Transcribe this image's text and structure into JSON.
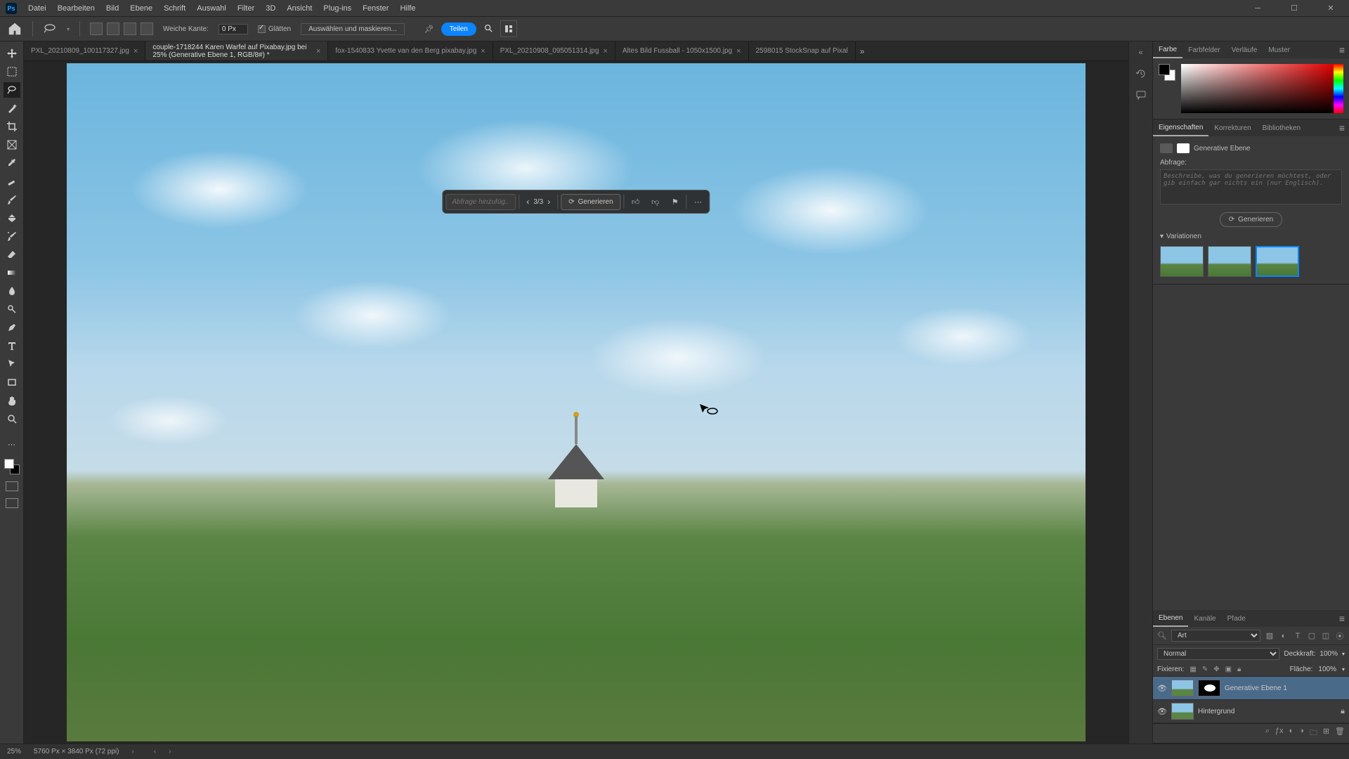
{
  "menu": [
    "Datei",
    "Bearbeiten",
    "Bild",
    "Ebene",
    "Schrift",
    "Auswahl",
    "Filter",
    "3D",
    "Ansicht",
    "Plug-ins",
    "Fenster",
    "Hilfe"
  ],
  "app_logo": "Ps",
  "options": {
    "feather_label": "Weiche Kante:",
    "feather_value": "0 Px",
    "antialias_label": "Glätten",
    "select_mask_label": "Auswählen und maskieren...",
    "share_label": "Teilen"
  },
  "tabs": [
    {
      "title": "PXL_20210809_100117327.jpg",
      "active": false
    },
    {
      "title": "couple-1718244 Karen Warfel auf Pixabay.jpg bei 25% (Generative Ebene 1, RGB/8#) *",
      "active": true
    },
    {
      "title": "fox-1540833 Yvette van den Berg pixabay.jpg",
      "active": false
    },
    {
      "title": "PXL_20210908_095051314.jpg",
      "active": false
    },
    {
      "title": "Altes Bild Fussball - 1050x1500.jpg",
      "active": false
    },
    {
      "title": "2598015 StockSnap auf Pixal",
      "active": false
    }
  ],
  "genbar": {
    "placeholder": "Abfrage hinzufüg...",
    "counter": "3/3",
    "generate_label": "Generieren"
  },
  "color_panel": {
    "tabs": [
      "Farbe",
      "Farbfelder",
      "Verläufe",
      "Muster"
    ]
  },
  "props_panel": {
    "tabs": [
      "Eigenschaften",
      "Korrekturen",
      "Bibliotheken"
    ],
    "layer_type": "Generative Ebene",
    "query_label": "Abfrage:",
    "query_placeholder": "Beschreibe, was du generieren möchtest, oder gib einfach gar nichts ein (nur Englisch).",
    "generate_label": "Generieren",
    "variations_label": "Variationen"
  },
  "layers_panel": {
    "tabs": [
      "Ebenen",
      "Kanäle",
      "Pfade"
    ],
    "filter_kind_label": "Art",
    "blend_mode": "Normal",
    "opacity_label": "Deckkraft:",
    "opacity_value": "100%",
    "lock_label": "Fixieren:",
    "fill_label": "Fläche:",
    "fill_value": "100%",
    "layers": [
      {
        "name": "Generative Ebene 1",
        "selected": true,
        "has_mask": true,
        "locked": false
      },
      {
        "name": "Hintergrund",
        "selected": false,
        "has_mask": false,
        "locked": true
      }
    ]
  },
  "status": {
    "zoom": "25%",
    "info": "5760 Px × 3840 Px (72 ppi)"
  }
}
